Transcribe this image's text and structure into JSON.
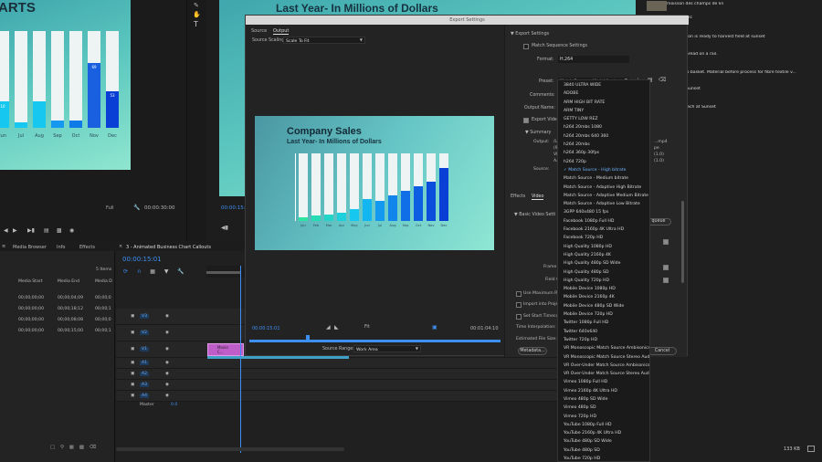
{
  "left_monitor": {
    "title_fragment": "ARTS",
    "months": [
      "Jun",
      "Jul",
      "Aug",
      "Sep",
      "Oct",
      "Nov",
      "Dec"
    ],
    "values": [
      "10",
      "",
      "",
      "",
      "",
      "69",
      "53"
    ],
    "fit": "Full",
    "timecode": "00:00:30:00"
  },
  "program_top": {
    "headline": "Last Year- In Millions of Dollars",
    "timecode_fragment": "00:00:15:"
  },
  "project_panel": {
    "tabs": [
      "Media Browser",
      "Info",
      "Effects"
    ],
    "items_count": "5 Items",
    "columns": [
      "Media Start",
      "Media End",
      "Media D"
    ],
    "rows": [
      [
        "00;00;00;00",
        "00;00;04;09",
        "00;00;0"
      ],
      [
        "00;00;00;00",
        "00;00;18;12",
        "00;00;1"
      ],
      [
        "00;00;00;00",
        "00;00;08;08",
        "00;00;0"
      ],
      [
        "00;00;00;00",
        "00;00;15;00",
        "00;00;1"
      ]
    ]
  },
  "timeline": {
    "sequence_name": "3 - Animated Business Chart Callouts",
    "timecode": "00:00:15:01",
    "video_tracks": [
      "V3",
      "V2",
      "V1"
    ],
    "audio_tracks": [
      "A1",
      "A2",
      "A3",
      "A4"
    ],
    "master": "Master",
    "master_value": "0.0",
    "clip_label": "Movie C..."
  },
  "export_dialog": {
    "title": "Export Settings",
    "tabs": [
      "Source",
      "Output"
    ],
    "source_scaling_label": "Source Scaling:",
    "source_scaling_value": "Scale To Fit",
    "preview": {
      "title": "Company Sales",
      "subtitle": "Last Year- In Millions of Dollars",
      "months": [
        "Jan",
        "Feb",
        "Mar",
        "Apr",
        "May",
        "Jun",
        "Jul",
        "Aug",
        "Sep",
        "Oct",
        "Nov",
        "Dec"
      ],
      "values": [
        "",
        "",
        "",
        "",
        "",
        "",
        "",
        "",
        "",
        "",
        "",
        ""
      ],
      "fill_fraction": [
        0.05,
        0.08,
        0.1,
        0.12,
        0.18,
        0.32,
        0.3,
        0.38,
        0.44,
        0.52,
        0.58,
        0.78
      ]
    },
    "timecode_in": "00:00:15:01",
    "timecode_out": "00:01:04:10",
    "fit": "Fit",
    "source_range_label": "Source Range:",
    "source_range_value": "Work Area",
    "settings": {
      "section": "Export Settings",
      "match_sequence": "Match Sequence Settings",
      "format_label": "Format:",
      "format_value": "H.264",
      "preset_label": "Preset:",
      "preset_value": "Match Source - High bitrate",
      "comments_label": "Comments:",
      "output_name_label": "Output Name:",
      "export_video": "Export Video",
      "summary_label": "Summary",
      "output_label": "Output:",
      "source_label": "Source:",
      "summary_frag": [
        "/Use",
        "(9)",
        "VBI",
        "AAC"
      ],
      "summary_right": [
        "...mp4",
        "pe",
        "(1.0)",
        "(1.0)"
      ],
      "tabs": [
        "Effects",
        "Video"
      ],
      "basic_video": "Basic Video Setti",
      "rows_frag": [
        "Frame",
        "Field O"
      ],
      "queue": "queue",
      "use_max_render": "Use Maximum Rend",
      "import_into_project": "Import into Project",
      "set_start_timecode": "Set Start Timecode",
      "time_interpolation": "Time Interpolation:",
      "estimated_file_size": "Estimated File Size:",
      "metadata_button": "Metadata...",
      "cancel_button": "Cancel"
    },
    "preset_options": [
      "3840 ULTRA WIDE",
      "ADOBE",
      "ARM HIGH BIT RATE",
      "ARM TINY",
      "GETTY LOW REZ",
      "h264 20mbs 1080",
      "h264 20mbs 640 360",
      "h264 20mbs",
      "h264 360p 30fps",
      "h264 720p",
      "Match Source - High bitrate",
      "Match Source - Medium bitrate",
      "Match Source - Adaptive High Bitrate",
      "Match Source - Adaptive Medium Bitrate",
      "Match Source - Adaptive Low Bitrate",
      "3GPP 640x480 15 fps",
      "Facebook 1080p Full HD",
      "Facebook 2160p 4K Ultra HD",
      "Facebook 720p HD",
      "High Quality 1080p HD",
      "High Quality 2160p 4K",
      "High Quality 480p SD Wide",
      "High Quality 480p SD",
      "High Quality 720p HD",
      "Mobile Device 1080p HD",
      "Mobile Device 2160p 4K",
      "Mobile Device 480p SD Wide",
      "Mobile Device 720p HD",
      "Twitter 1080p Full HD",
      "Twitter 640x640",
      "Twitter 720p HD",
      "VR Monoscopic Match Source Ambisonics",
      "VR Monoscopic Match Source Stereo Audio",
      "VR Over-Under Match Source Ambisonics",
      "VR Over-Under Match Source Stereo Audio",
      "Vimeo 1080p Full HD",
      "Vimeo 2160p 4K Ultra HD",
      "Vimeo 480p SD Wide",
      "Vimeo 480p SD",
      "Vimeo 720p HD",
      "YouTube 1080p Full HD",
      "YouTube 2160p 4K Ultra HD",
      "YouTube 480p SD Wide",
      "YouTube 480p SD",
      "YouTube 720p HD"
    ],
    "selected_index": 10
  },
  "stock_list": {
    "items": [
      "moisson des champs de lin",
      "duces fabric",
      "uality cotton is ready to harvest field at sunset",
      "raw silk thread on a rail.",
      "in bamboo basket. Material before process for fibre textile v...",
      "urfing at Sunset",
      "on the Beach at Sunset"
    ],
    "size_readout": "133 KB"
  },
  "colors": {
    "accent_blue": "#3d8ff3",
    "bar_blue_dark": "#0a3fd6",
    "bar_cyan": "#16c8f0",
    "bar_green": "#2fe3a0",
    "panel_bg": "#232323"
  }
}
